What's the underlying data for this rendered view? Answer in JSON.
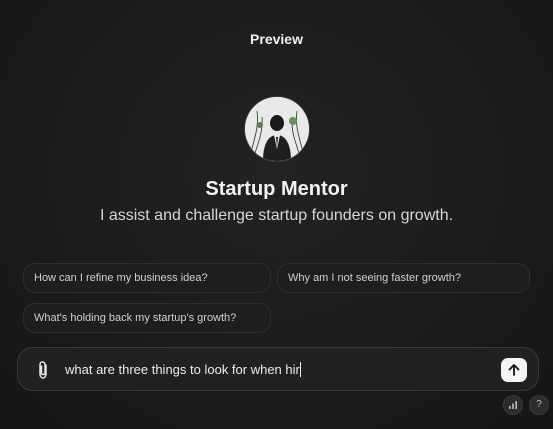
{
  "header": {
    "title": "Preview"
  },
  "gpt": {
    "name": "Startup Mentor",
    "description": "I assist and challenge startup founders on growth."
  },
  "starters": [
    {
      "label": "How can I refine my business idea?"
    },
    {
      "label": "Why am I not seeing faster growth?"
    },
    {
      "label": "What's holding back my startup's growth?"
    }
  ],
  "composer": {
    "value": "what are three things to look for when hir"
  },
  "icons": {
    "attach": "paperclip-icon",
    "send": "arrow-up-icon",
    "stats": "bar-chart-icon",
    "help": "question-mark-icon"
  },
  "footer": {
    "help_label": "?"
  }
}
